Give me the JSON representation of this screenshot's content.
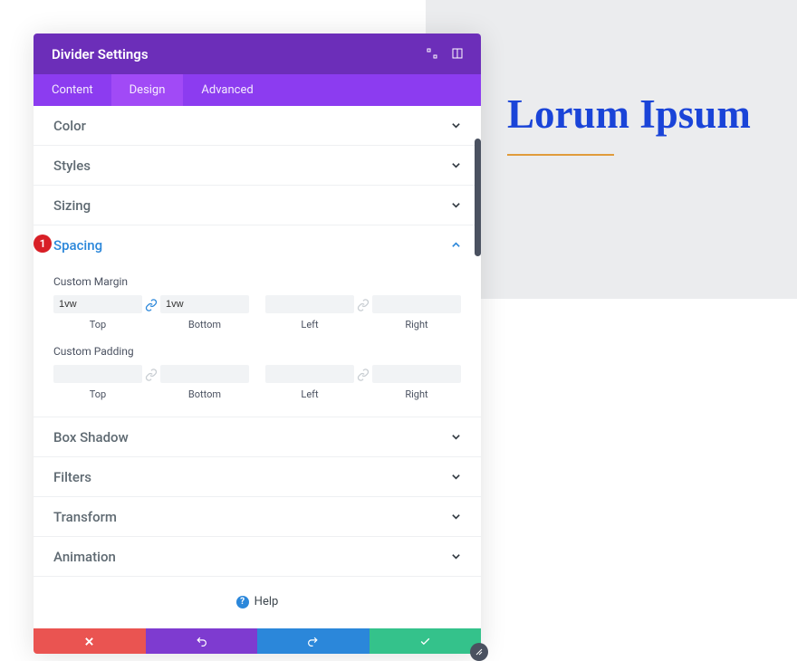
{
  "preview": {
    "heading": "Lorum Ipsum"
  },
  "modal": {
    "title": "Divider Settings",
    "tabs": {
      "content": "Content",
      "design": "Design",
      "advanced": "Advanced"
    },
    "sections": {
      "color": "Color",
      "styles": "Styles",
      "sizing": "Sizing",
      "spacing": "Spacing",
      "boxshadow": "Box Shadow",
      "filters": "Filters",
      "transform": "Transform",
      "animation": "Animation"
    },
    "spacing": {
      "margin_label": "Custom Margin",
      "padding_label": "Custom Padding",
      "labels": {
        "top": "Top",
        "bottom": "Bottom",
        "left": "Left",
        "right": "Right"
      },
      "margin": {
        "top": "1vw",
        "bottom": "1vw",
        "left": "",
        "right": ""
      },
      "padding": {
        "top": "",
        "bottom": "",
        "left": "",
        "right": ""
      },
      "link_states": {
        "margin_tb": "linked",
        "margin_lr": "unlinked",
        "padding_tb": "unlinked",
        "padding_lr": "unlinked"
      }
    },
    "help": "Help",
    "annotation": "1"
  },
  "colors": {
    "link_active": "#2b87da",
    "link_inactive": "#c8cdd2"
  }
}
